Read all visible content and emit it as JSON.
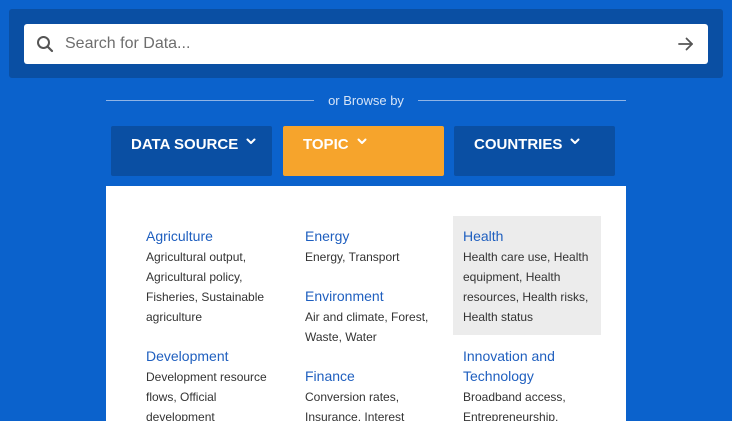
{
  "search": {
    "placeholder": "Search for Data..."
  },
  "browse": {
    "divider_text": "or Browse by"
  },
  "tabs": [
    {
      "label": "DATA SOURCE",
      "active": false
    },
    {
      "label": "TOPIC",
      "active": true
    },
    {
      "label": "COUNTRIES",
      "active": false
    }
  ],
  "topics": [
    {
      "title": "Agriculture",
      "subtitle": "Agricultural output, Agricultural policy, Fisheries, Sustainable agriculture"
    },
    {
      "title": "Development",
      "subtitle": "Development resource flows, Official development"
    },
    {
      "title": "Energy",
      "subtitle": "Energy, Transport"
    },
    {
      "title": "Environment",
      "subtitle": "Air and climate, Forest, Waste, Water"
    },
    {
      "title": "Finance",
      "subtitle": "Conversion rates, Insurance, Interest"
    },
    {
      "title": "Health",
      "subtitle": "Health care use, Health equipment, Health resources, Health risks, Health status"
    },
    {
      "title": "Innovation and Technology",
      "subtitle": "Broadband access, Entrepreneurship,"
    }
  ],
  "colors": {
    "background": "#0b62cc",
    "dark_blue": "#0a4fa3",
    "accent_orange": "#f6a42c",
    "link_blue": "#1f5fbf",
    "hover_gray": "#ececec"
  },
  "icons": {
    "search": "search-icon",
    "submit": "arrow-right-icon",
    "tab_chevron": "chevron-down-icon"
  }
}
